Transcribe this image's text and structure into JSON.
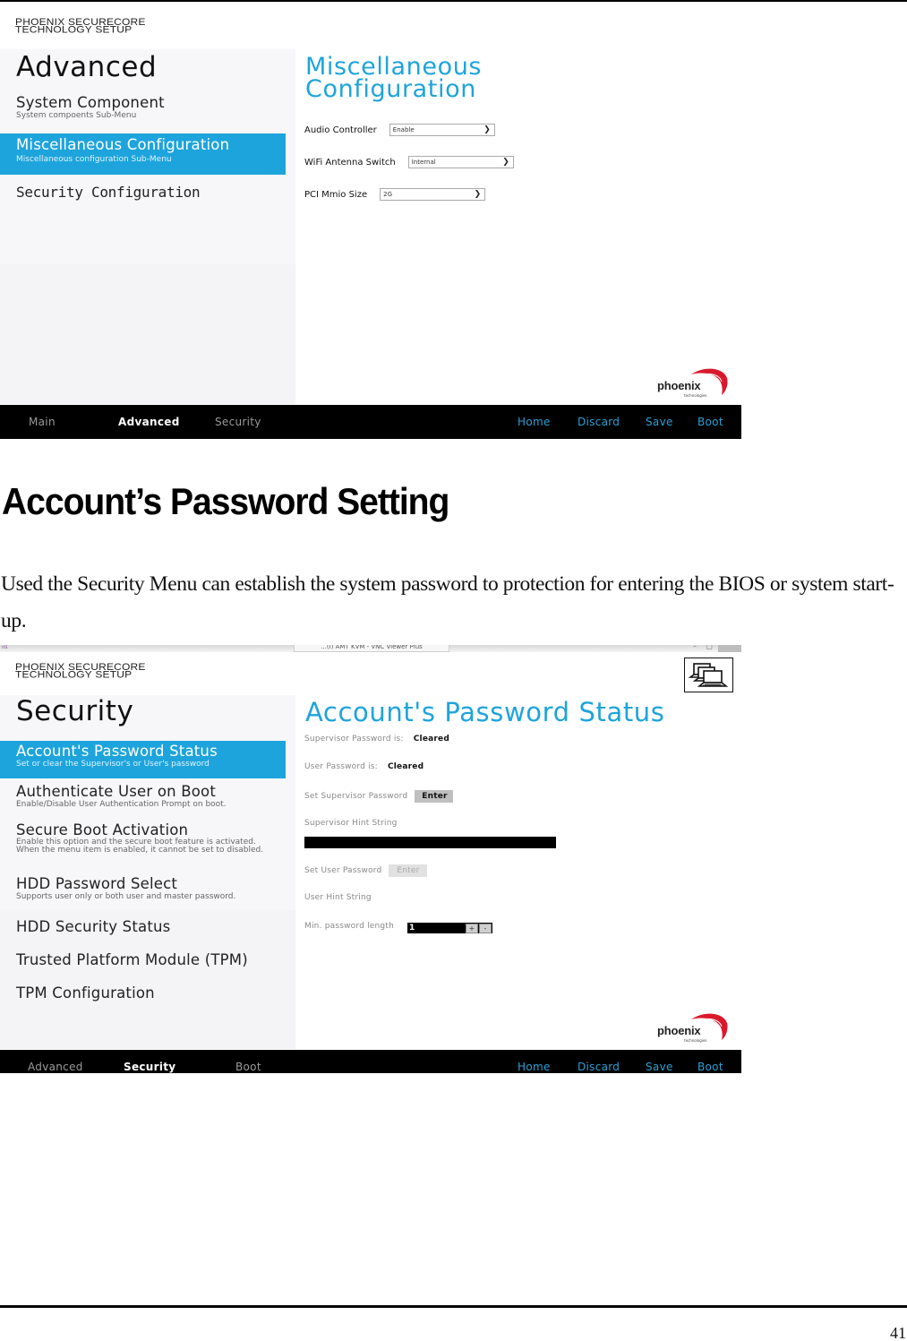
{
  "screenshot_1": {
    "vendor_line1": "PHOENIX SECURECORE",
    "vendor_line2": "TECHNOLOGY SETUP",
    "sidebar": {
      "title": "Advanced",
      "items": [
        {
          "title": "System Component",
          "subtitle": "System compoents Sub-Menu",
          "selected": false
        },
        {
          "title": "Miscellaneous Configuration",
          "subtitle": "Miscellaneous configuration Sub-Menu",
          "selected": true
        },
        {
          "title": "Security Configuration",
          "subtitle": "",
          "selected": false
        }
      ]
    },
    "content": {
      "title_line1": "Miscellaneous",
      "title_line2": "Configuration",
      "fields": [
        {
          "label": "Audio Controller",
          "value": "Enable"
        },
        {
          "label": "WiFi Antenna Switch",
          "value": "Internal"
        },
        {
          "label": "PCI Mmio Size",
          "value": "2G"
        }
      ]
    },
    "logo": {
      "word": "phoenix",
      "sub": "technologies"
    },
    "navbar": {
      "tabs": [
        {
          "label": "Main",
          "active": false
        },
        {
          "label": "Advanced",
          "active": true
        },
        {
          "label": "Security",
          "active": false
        }
      ],
      "actions": [
        "Home",
        "Discard",
        "Save",
        "Boot"
      ]
    }
  },
  "document": {
    "heading": "Account’s Password Setting",
    "paragraph": "Used the Security Menu can establish the system password to protection for entering the BIOS or system start-up."
  },
  "screenshot_2": {
    "window": {
      "title": "...(I) AMT KVM - VNC Viewer Plus",
      "controls": "– ▢"
    },
    "vendor_line1": "PHOENIX SECURECORE",
    "vendor_line2": "TECHNOLOGY SETUP",
    "remote_icon": "remote-computers-icon",
    "sidebar": {
      "title": "Security",
      "items": [
        {
          "title": "Account's Password Status",
          "subtitle": "Set or clear the Supervisor's or User's password",
          "selected": true
        },
        {
          "title": "Authenticate User on Boot",
          "subtitle": "Enable/Disable User Authentication Prompt on boot.",
          "selected": false
        },
        {
          "title": "Secure Boot Activation",
          "subtitle": "Enable this option and the secure boot feature is activated. When the menu item is enabled, it cannot be set to disabled.",
          "selected": false
        },
        {
          "title": "HDD Password Select",
          "subtitle": "Supports user only or both user and master password.",
          "selected": false
        },
        {
          "title": "HDD Security Status",
          "subtitle": "",
          "selected": false
        },
        {
          "title": "Trusted Platform Module (TPM)",
          "subtitle": "",
          "selected": false
        },
        {
          "title": "TPM Configuration",
          "subtitle": "",
          "selected": false
        }
      ]
    },
    "content": {
      "title": "Account's Password Status",
      "supervisor_status_label": "Supervisor Password is:",
      "supervisor_status_value": "Cleared",
      "user_status_label": "User Password is:",
      "user_status_value": "Cleared",
      "set_supervisor_label": "Set Supervisor Password",
      "set_supervisor_button": "Enter",
      "supervisor_hint_label": "Supervisor Hint String",
      "supervisor_hint_value": "",
      "set_user_label": "Set User Password",
      "set_user_button": "Enter",
      "user_hint_label": "User Hint String",
      "min_length_label": "Min. password length",
      "min_length_value": "1",
      "increment": "+",
      "decrement": "-"
    },
    "logo": {
      "word": "phoenix",
      "sub": "technologies"
    },
    "navbar": {
      "tabs": [
        {
          "label": "Advanced",
          "active": false
        },
        {
          "label": "Security",
          "active": true
        },
        {
          "label": "Boot",
          "active": false
        }
      ],
      "actions": [
        "Home",
        "Discard",
        "Save",
        "Boot"
      ]
    }
  },
  "page": {
    "number": "41"
  },
  "colors": {
    "accent": "#1ea4dc",
    "nav_action": "#2aa0d6",
    "navbar_bg": "#000000",
    "sidebar_bg": "#f4f3f5",
    "logo_red": "#d9192b"
  }
}
